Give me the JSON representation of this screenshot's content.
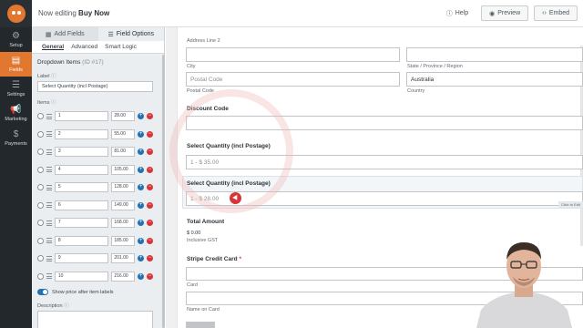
{
  "app": {
    "title_prefix": "Now editing",
    "title_form": "Buy Now",
    "help_label": "Help",
    "preview_label": "Preview",
    "embed_label": "Embed"
  },
  "rail": [
    {
      "label": "Setup",
      "icon": "gear-icon",
      "glyph": "⚙",
      "active": false
    },
    {
      "label": "Fields",
      "icon": "fields-icon",
      "glyph": "▤",
      "active": true
    },
    {
      "label": "Settings",
      "icon": "sliders-icon",
      "glyph": "☰",
      "active": false
    },
    {
      "label": "Marketing",
      "icon": "megaphone-icon",
      "glyph": "📢",
      "active": false
    },
    {
      "label": "Payments",
      "icon": "dollar-icon",
      "glyph": "$",
      "active": false
    }
  ],
  "panel": {
    "tab_add": "Add Fields",
    "tab_options": "Field Options",
    "subtabs": [
      "General",
      "Advanced",
      "Smart Logic"
    ],
    "section_title": "Dropdown Items",
    "section_id": "(ID #17)",
    "label_caption": "Label",
    "label_value": "Select Quantity (incl Postage)",
    "items_caption": "Items",
    "items": [
      {
        "label": "1",
        "price": "28.00"
      },
      {
        "label": "2",
        "price": "55.00"
      },
      {
        "label": "3",
        "price": "81.00"
      },
      {
        "label": "4",
        "price": "105.00"
      },
      {
        "label": "5",
        "price": "128.00"
      },
      {
        "label": "6",
        "price": "149.00"
      },
      {
        "label": "7",
        "price": "168.00"
      },
      {
        "label": "8",
        "price": "185.00"
      },
      {
        "label": "9",
        "price": "201.00"
      },
      {
        "label": "10",
        "price": "216.00"
      }
    ],
    "toggle_label": "Show price after item labels",
    "description_caption": "Description"
  },
  "preview": {
    "address2_label": "Address Line 2",
    "city_label": "City",
    "state_label": "State / Province / Region",
    "postal_placeholder": "Postal Code",
    "postal_label": "Postal Code",
    "country_value": "Australia",
    "country_label": "Country",
    "discount_title": "Discount Code",
    "quantity1_title": "Select Quantity (incl Postage)",
    "quantity1_value": "1 - $ 35.00",
    "quantity2_title": "Select Quantity (incl Postage)",
    "quantity2_value": "1 - $ 28.00",
    "click_to_edit": "Click to Edit",
    "total_title": "Total Amount",
    "total_value": "$ 0.00",
    "total_note": "Inclusive GST",
    "stripe_title": "Stripe Credit Card",
    "stripe_required": "*",
    "card_label": "Card",
    "name_label": "Name on Card"
  }
}
